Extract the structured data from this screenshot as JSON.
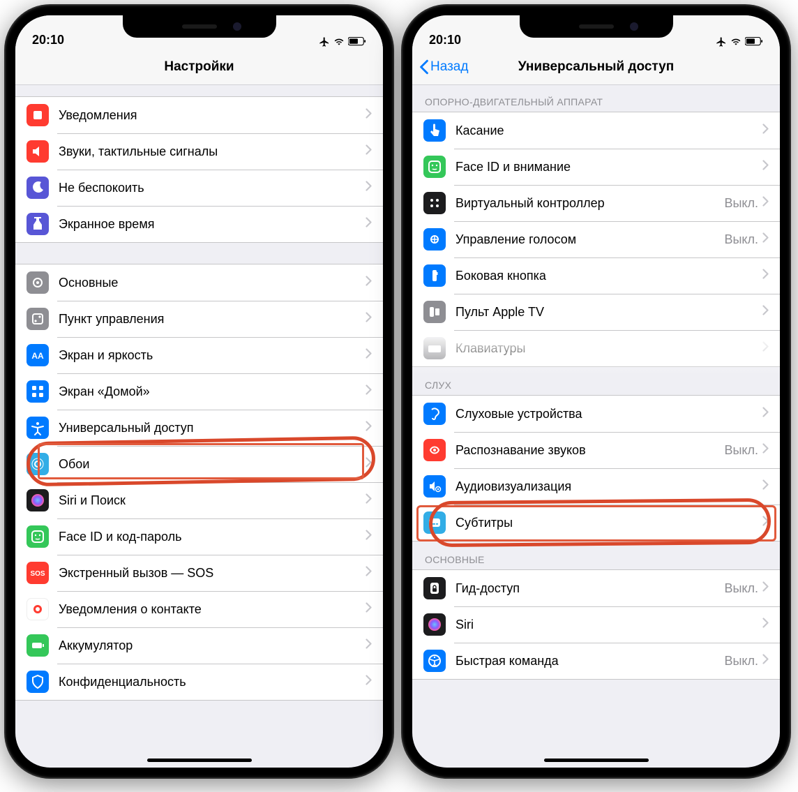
{
  "statusbar": {
    "time": "20:10"
  },
  "colors": {
    "blue": "#007aff",
    "red": "#ff3b30",
    "purple": "#5856d6",
    "green": "#34c759",
    "gray": "#8e8e93",
    "dark": "#1c1c1e",
    "orange": "#ff9500",
    "teal": "#32ade6"
  },
  "left": {
    "title": "Настройки",
    "group1": [
      {
        "key": "notifications",
        "label": "Уведомления",
        "icon": "red"
      },
      {
        "key": "sounds",
        "label": "Звуки, тактильные сигналы",
        "icon": "red"
      },
      {
        "key": "dnd",
        "label": "Не беспокоить",
        "icon": "purple"
      },
      {
        "key": "screentime",
        "label": "Экранное время",
        "icon": "purple"
      }
    ],
    "group2": [
      {
        "key": "general",
        "label": "Основные",
        "icon": "gray"
      },
      {
        "key": "controlcenter",
        "label": "Пункт управления",
        "icon": "gray"
      },
      {
        "key": "display",
        "label": "Экран и яркость",
        "icon": "blue"
      },
      {
        "key": "homescreen",
        "label": "Экран «Домой»",
        "icon": "blue"
      },
      {
        "key": "accessibility",
        "label": "Универсальный доступ",
        "icon": "blue",
        "highlighted": true
      },
      {
        "key": "wallpaper",
        "label": "Обои",
        "icon": "teal"
      },
      {
        "key": "siri",
        "label": "Siri и Поиск",
        "icon": "dark"
      },
      {
        "key": "faceid",
        "label": "Face ID и код-пароль",
        "icon": "green"
      },
      {
        "key": "sos",
        "label": "Экстренный вызов — SOS",
        "icon": "red"
      },
      {
        "key": "exposure",
        "label": "Уведомления о контакте",
        "icon": "red-white"
      },
      {
        "key": "battery",
        "label": "Аккумулятор",
        "icon": "green"
      },
      {
        "key": "privacy",
        "label": "Конфиденциальность",
        "icon": "blue"
      }
    ]
  },
  "right": {
    "title": "Универсальный доступ",
    "back": "Назад",
    "sections": [
      {
        "header": "ОПОРНО-ДВИГАТЕЛЬНЫЙ АППАРАТ",
        "items": [
          {
            "key": "touch",
            "label": "Касание",
            "icon": "blue"
          },
          {
            "key": "faceid",
            "label": "Face ID и внимание",
            "icon": "green"
          },
          {
            "key": "switch",
            "label": "Виртуальный контроллер",
            "icon": "dark",
            "value": "Выкл."
          },
          {
            "key": "voice",
            "label": "Управление голосом",
            "icon": "blue",
            "value": "Выкл."
          },
          {
            "key": "side",
            "label": "Боковая кнопка",
            "icon": "blue"
          },
          {
            "key": "appletv",
            "label": "Пульт Apple TV",
            "icon": "gray"
          },
          {
            "key": "keyboards",
            "label": "Клавиатуры",
            "icon": "gray"
          }
        ]
      },
      {
        "header": "СЛУХ",
        "items": [
          {
            "key": "hearingdev",
            "label": "Слуховые устройства",
            "icon": "blue"
          },
          {
            "key": "soundrec",
            "label": "Распознавание звуков",
            "icon": "red",
            "value": "Выкл."
          },
          {
            "key": "audiovis",
            "label": "Аудиовизуализация",
            "icon": "blue",
            "highlighted": true
          },
          {
            "key": "subtitles",
            "label": "Субтитры",
            "icon": "teal"
          }
        ]
      },
      {
        "header": "ОСНОВНЫЕ",
        "items": [
          {
            "key": "guided",
            "label": "Гид-доступ",
            "icon": "dark",
            "value": "Выкл."
          },
          {
            "key": "siri2",
            "label": "Siri",
            "icon": "dark"
          },
          {
            "key": "shortcut",
            "label": "Быстрая команда",
            "icon": "blue",
            "value": "Выкл."
          }
        ]
      }
    ]
  }
}
